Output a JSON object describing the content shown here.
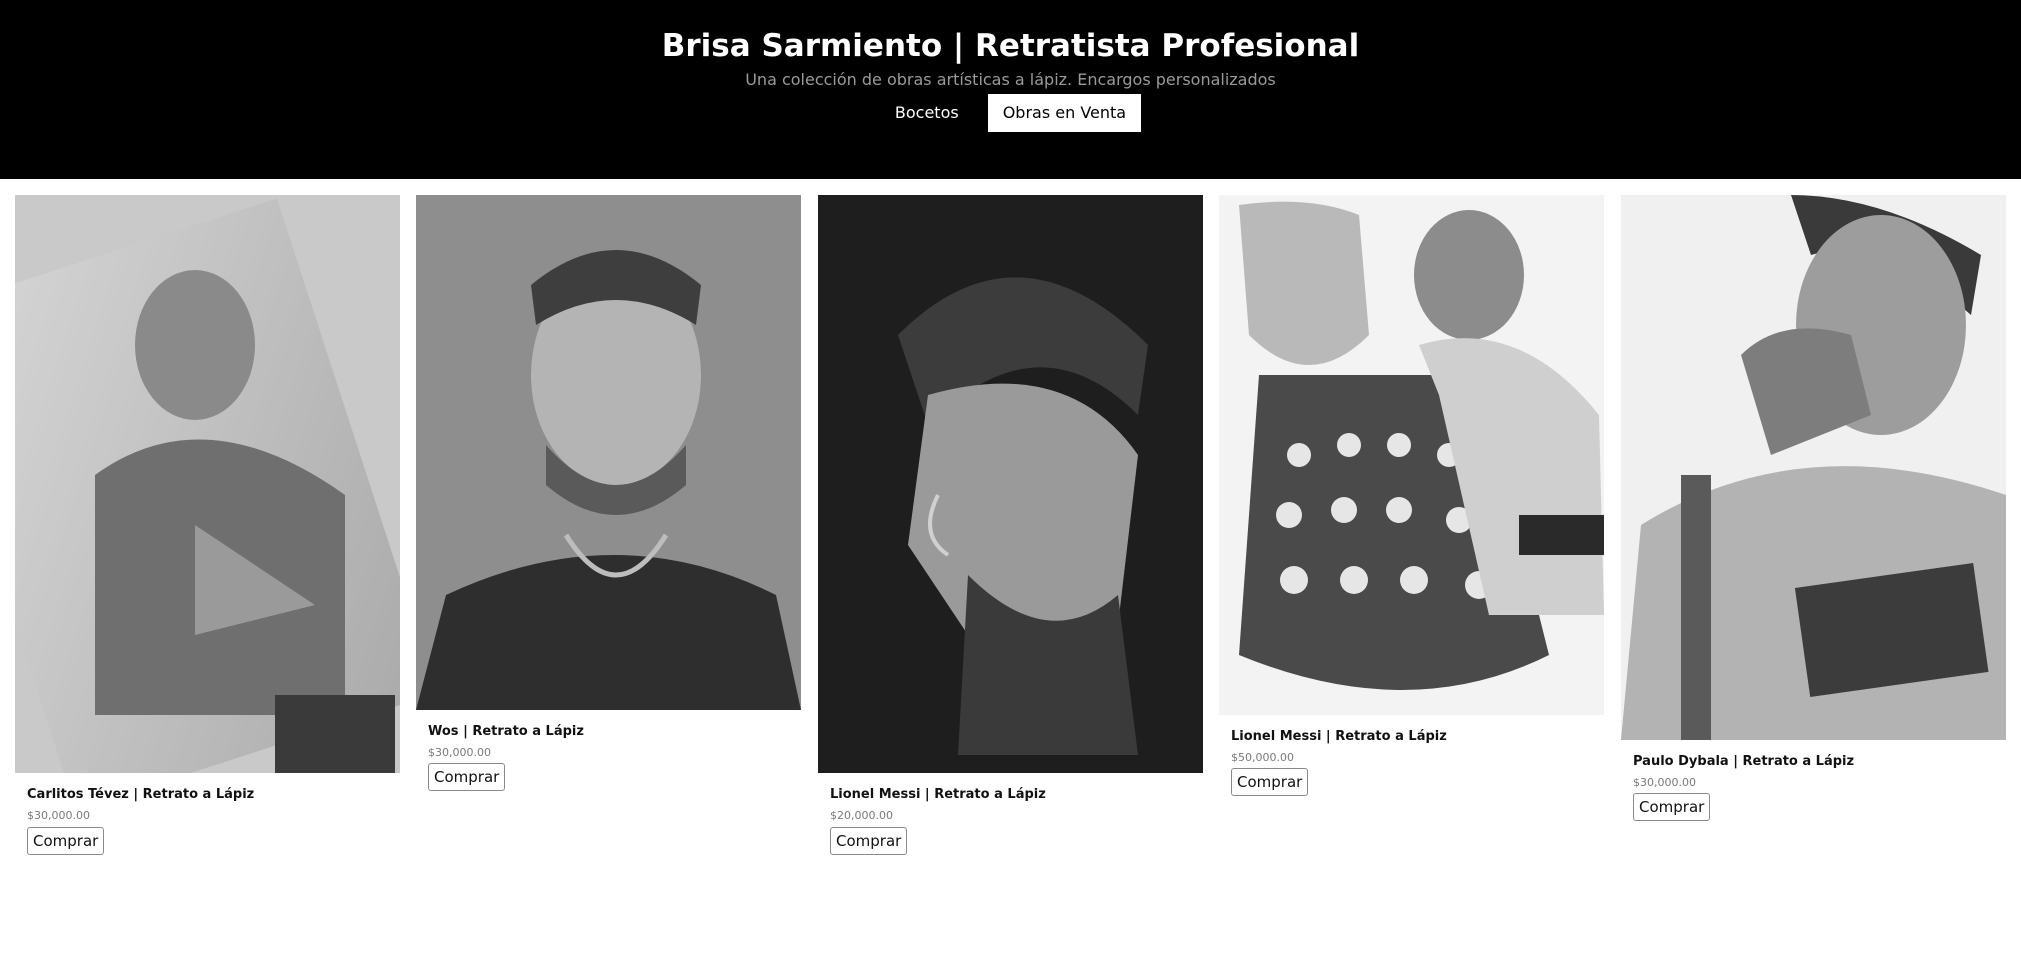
{
  "header": {
    "title": "Brisa Sarmiento | Retratista Profesional",
    "subtitle": "Una colección de obras artísticas a lápiz. Encargos personalizados",
    "tabs": [
      {
        "label": "Bocetos",
        "active": false
      },
      {
        "label": "Obras en Venta",
        "active": true
      }
    ]
  },
  "products": [
    {
      "title": "Carlitos Tévez | Retrato a Lápiz",
      "price": "$30,000.00",
      "button": "Comprar"
    },
    {
      "title": "Wos | Retrato a Lápiz",
      "price": "$30,000.00",
      "button": "Comprar"
    },
    {
      "title": "Lionel Messi | Retrato a Lápiz",
      "price": "$20,000.00",
      "button": "Comprar"
    },
    {
      "title": "Lionel Messi | Retrato a Lápiz",
      "price": "$50,000.00",
      "button": "Comprar"
    },
    {
      "title": "Paulo Dybala | Retrato a Lápiz",
      "price": "$30,000.00",
      "button": "Comprar"
    }
  ],
  "colors": {
    "header_bg": "#000000",
    "header_text": "#ffffff",
    "subtitle_text": "#9a9a9a",
    "price_text": "#7a7a7a"
  }
}
